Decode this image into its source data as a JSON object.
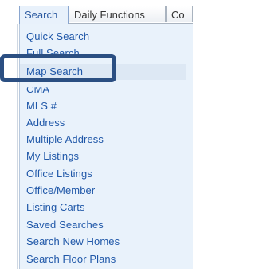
{
  "tabs": {
    "search": "Search",
    "daily_functions": "Daily Functions",
    "overflow": "Co"
  },
  "menu": {
    "items": [
      "Quick Search",
      "Full Search",
      "Map Search",
      "CMA",
      "MLS #",
      "Address",
      "Multiple Address",
      "My Listings",
      "Office Listings",
      "Office/Member",
      "Listing Carts",
      "Saved Searches",
      "Search New Homes",
      "Search Floor Plans"
    ],
    "highlighted": "Map Search"
  },
  "colors": {
    "link": "#1f57a8",
    "panel": "#e9f2fb",
    "callout_border": "#2b4f82"
  }
}
